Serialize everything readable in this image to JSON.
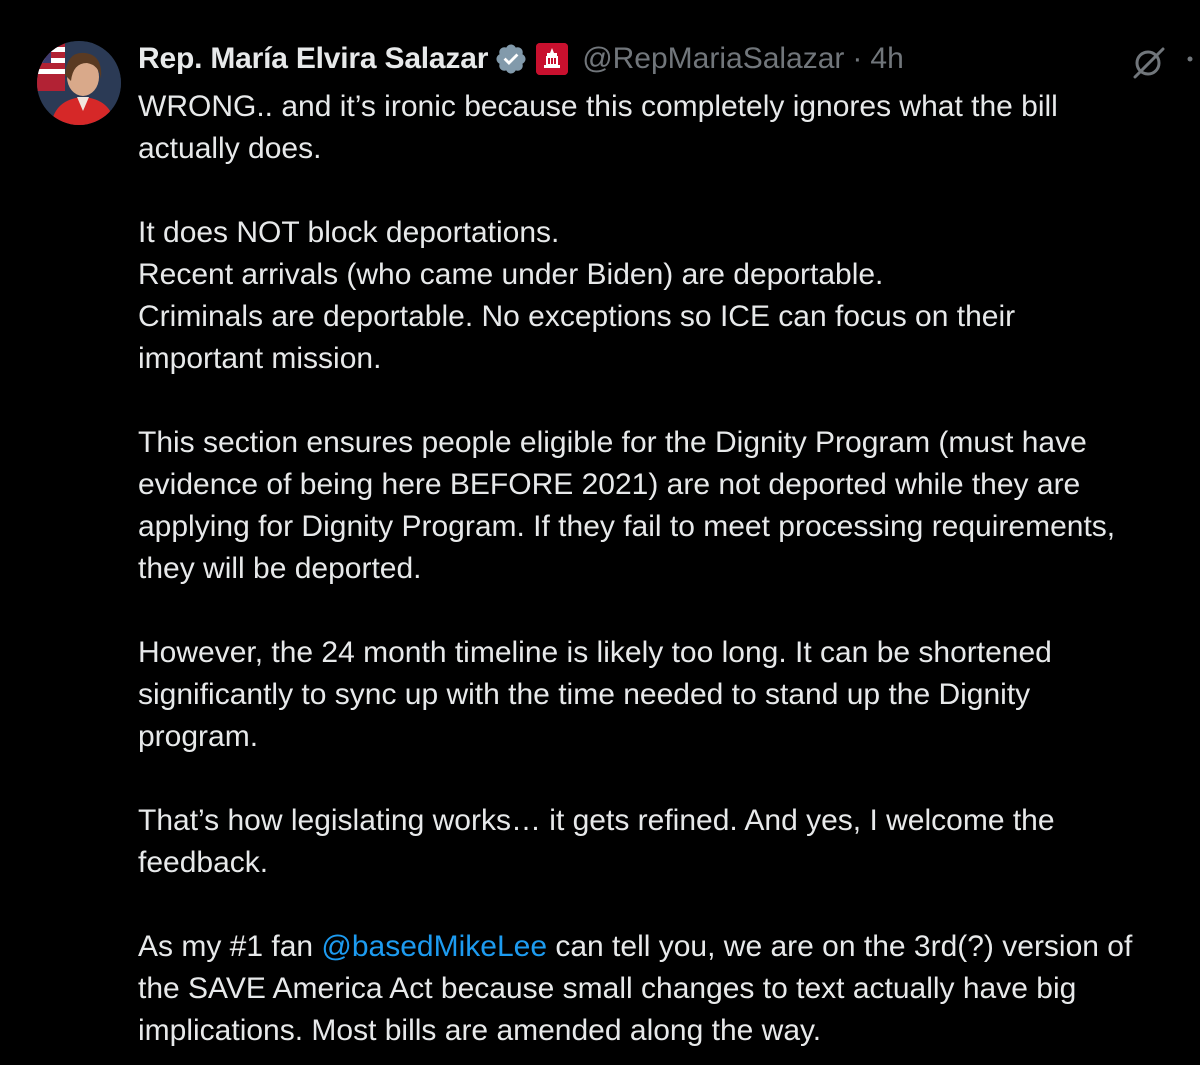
{
  "tweet": {
    "author_name": "Rep. María Elvira Salazar",
    "handle": "@RepMariaSalazar",
    "separator": "·",
    "time": "4h",
    "verified_color": "#829aab",
    "mention_color": "#1d9bf0",
    "paragraphs": [
      [
        "WRONG.. and it’s ironic because this completely ignores what the bill",
        "actually does."
      ],
      [
        "It does NOT block deportations.",
        "Recent arrivals (who came under Biden) are deportable.",
        "Criminals are deportable. No exceptions so ICE can focus on their",
        "important mission."
      ],
      [
        "This section ensures people eligible for the Dignity Program (must have",
        "evidence of being here BEFORE 2021) are not deported while they are",
        "applying for Dignity Program. If they fail to meet processing requirements,",
        "they will be deported."
      ],
      [
        "However, the 24 month timeline is likely too long. It can be shortened",
        "significantly to sync up with the time needed to stand up the Dignity",
        "program."
      ],
      [
        "That’s how legislating works… it gets refined. And yes, I welcome the",
        "feedback."
      ]
    ],
    "last_paragraph": {
      "line1_before": "As my #1 fan ",
      "mention": "@basedMikeLee",
      "line1_after": " can tell you, we are on the 3rd(?) version of",
      "line2": "the SAVE America Act because small changes to text actually have big",
      "line3": "implications. Most bills are amended along the way."
    }
  },
  "icons": {
    "avatar": "avatar",
    "verified": "verified-badge-icon",
    "flag": "government-affiliation-icon",
    "grok": "grok-icon",
    "more": "more-options-icon"
  }
}
